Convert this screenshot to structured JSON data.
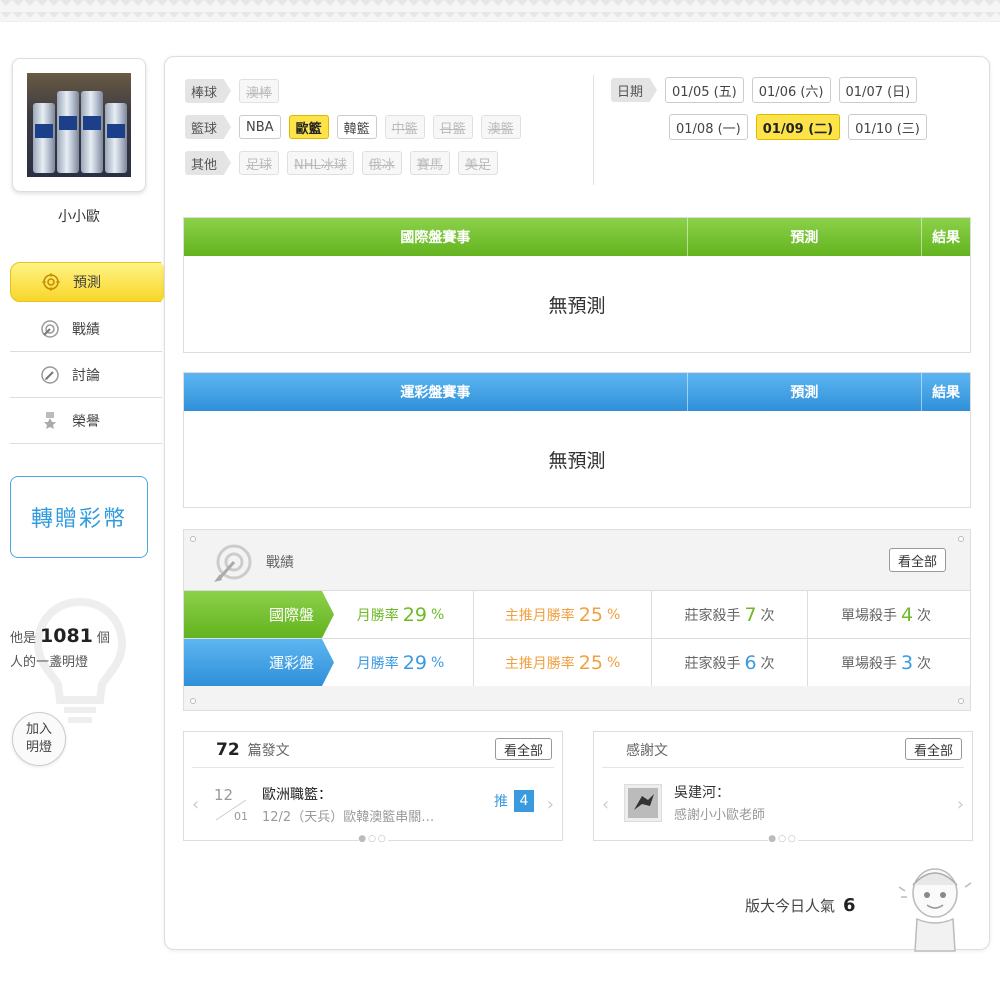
{
  "user": {
    "name": "小小歐"
  },
  "nav": [
    {
      "label": "預測",
      "icon": "target-icon",
      "active": true
    },
    {
      "label": "戰績",
      "icon": "dart-icon",
      "active": false
    },
    {
      "label": "討論",
      "icon": "chat-edit-icon",
      "active": false
    },
    {
      "label": "榮譽",
      "icon": "medal-icon",
      "active": false
    }
  ],
  "transfer_button": "轉贈彩幣",
  "lamp": {
    "prefix": "他是",
    "count": "1081",
    "suffix": "個",
    "line2": "人的一盞明燈",
    "join_line1": "加入",
    "join_line2": "明燈"
  },
  "filters": {
    "baseball": {
      "label": "棒球",
      "items": [
        "澳棒"
      ]
    },
    "basketball": {
      "label": "籃球",
      "items": [
        "NBA",
        "歐籃",
        "韓籃",
        "中籃",
        "日籃",
        "澳籃"
      ]
    },
    "other": {
      "label": "其他",
      "items": [
        "足球",
        "NHL冰球",
        "俄冰",
        "賽馬",
        "美足"
      ]
    }
  },
  "dates": {
    "label": "日期",
    "row1": [
      "01/05 (五)",
      "01/06 (六)",
      "01/07 (日)"
    ],
    "row2": [
      "01/08 (一)",
      "01/09 (二)",
      "01/10 (三)"
    ]
  },
  "intl_table": {
    "col1": "國際盤賽事",
    "col2": "預測",
    "col3": "結果",
    "empty": "無預測"
  },
  "sports_table": {
    "col1": "運彩盤賽事",
    "col2": "預測",
    "col3": "結果",
    "empty": "無預測"
  },
  "record": {
    "title": "戰績",
    "see_all": "看全部",
    "rows": [
      {
        "label": "國際盤",
        "month_label": "月勝率",
        "month_value": "29",
        "main_label": "主推月勝率",
        "main_value": "25",
        "pct": "%",
        "banker_label": "莊家殺手",
        "banker_value": "7",
        "single_label": "單場殺手",
        "single_value": "4",
        "times": "次"
      },
      {
        "label": "運彩盤",
        "month_label": "月勝率",
        "month_value": "29",
        "main_label": "主推月勝率",
        "main_value": "25",
        "pct": "%",
        "banker_label": "莊家殺手",
        "banker_value": "6",
        "single_label": "單場殺手",
        "single_value": "3",
        "times": "次"
      }
    ]
  },
  "posts": {
    "count": "72",
    "label": "篇發文",
    "see_all": "看全部",
    "item": {
      "month": "12",
      "day": "01",
      "title": "歐洲職籃：",
      "snippet": "12/2（天兵）歐韓澳籃串關…",
      "push_label": "推",
      "push_count": "4"
    }
  },
  "thanks": {
    "label": "感謝文",
    "see_all": "看全部",
    "item": {
      "author": "吳建河：",
      "text": "感謝小小歐老師"
    }
  },
  "popularity": {
    "label": "版大今日人氣",
    "value": "6"
  },
  "colors": {
    "green": "#6cbb26",
    "blue": "#3a9ae0",
    "orange": "#f0a040",
    "yellow": "#fde34a"
  }
}
